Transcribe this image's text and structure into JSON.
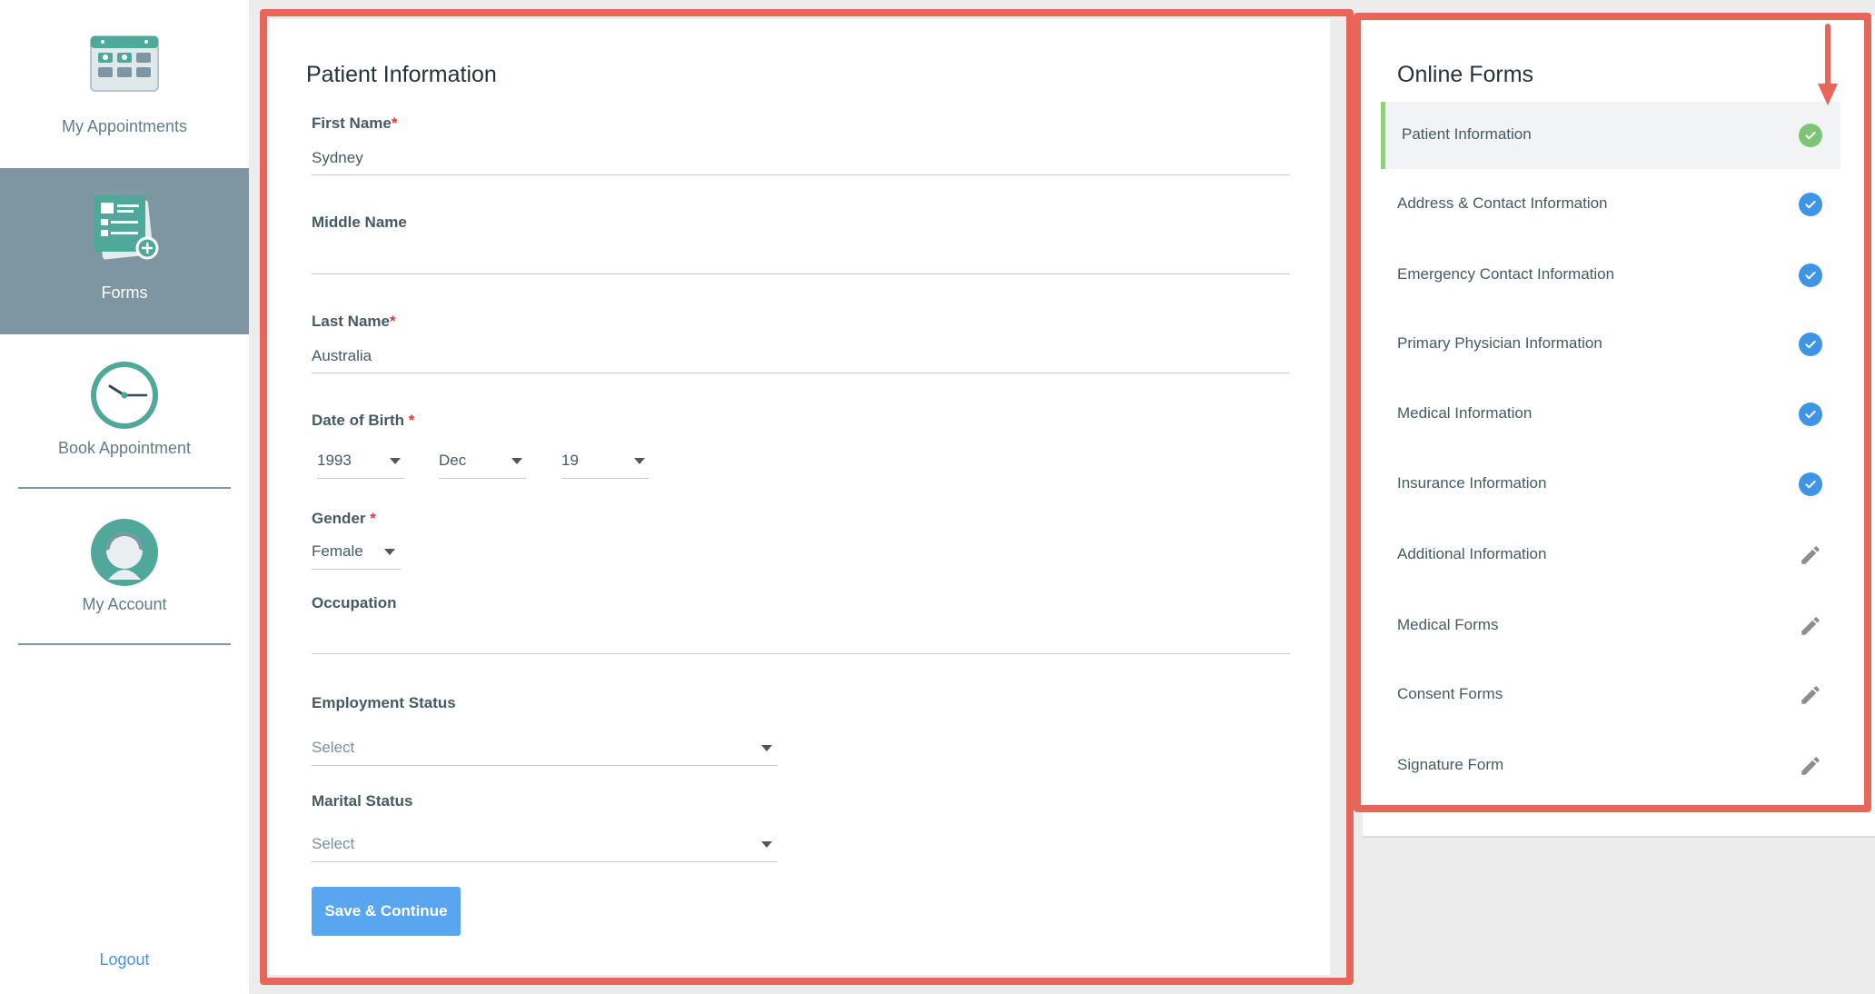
{
  "nav": {
    "items": [
      {
        "label": "My Appointments",
        "icon": "calendar-icon"
      },
      {
        "label": "Forms",
        "icon": "forms-icon"
      },
      {
        "label": "Book Appointment",
        "icon": "clock-icon"
      },
      {
        "label": "My Account",
        "icon": "user-icon"
      }
    ],
    "logout": "Logout",
    "active": "Forms"
  },
  "form": {
    "title": "Patient Information",
    "first_name_label": "First Name",
    "first_name_value": "Sydney",
    "middle_name_label": "Middle Name",
    "middle_name_value": "",
    "last_name_label": "Last Name",
    "last_name_value": "Australia",
    "dob_label": "Date of Birth",
    "dob_year": "1993",
    "dob_month": "Dec",
    "dob_day": "19",
    "gender_label": "Gender",
    "gender_value": "Female",
    "occupation_label": "Occupation",
    "occupation_value": "",
    "employment_label": "Employment Status",
    "employment_value": "Select",
    "marital_label": "Marital Status",
    "marital_value": "Select",
    "required_mark": "*",
    "save_button": "Save & Continue"
  },
  "online_forms": {
    "title": "Online Forms",
    "items": [
      {
        "label": "Patient Information",
        "status": "complete-active"
      },
      {
        "label": "Address & Contact Information",
        "status": "complete"
      },
      {
        "label": "Emergency Contact Information",
        "status": "complete"
      },
      {
        "label": "Primary Physician Information",
        "status": "complete"
      },
      {
        "label": "Medical Information",
        "status": "complete"
      },
      {
        "label": "Insurance Information",
        "status": "complete"
      },
      {
        "label": "Additional Information",
        "status": "edit"
      },
      {
        "label": "Medical Forms",
        "status": "edit"
      },
      {
        "label": "Consent Forms",
        "status": "edit"
      },
      {
        "label": "Signature Form",
        "status": "edit"
      }
    ]
  },
  "colors": {
    "accent_blue": "#3e95e6",
    "complete_green": "#7cc576",
    "nav_active": "#7e96a1",
    "highlight_red": "#e8655a",
    "brand_teal": "#4fa89a"
  }
}
